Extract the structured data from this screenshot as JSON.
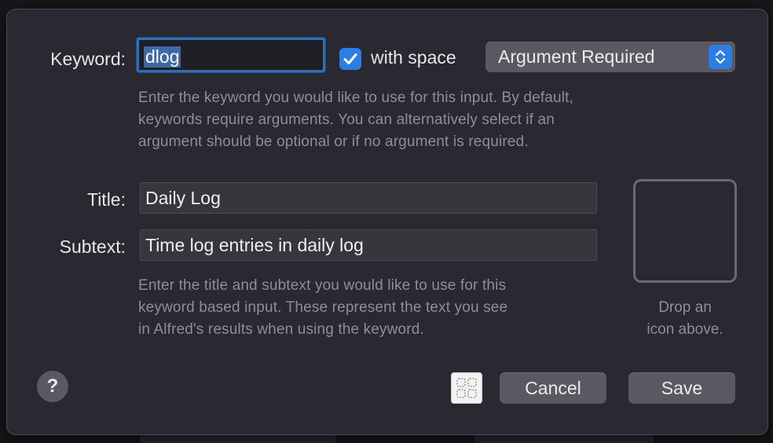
{
  "keyword": {
    "label": "Keyword:",
    "value": "dlog",
    "with_space_checked": true,
    "with_space_label": "with space",
    "argument_option": "Argument Required",
    "help": "Enter the keyword you would like to use for this input. By default, keywords require arguments. You can alternatively select if an argument should be optional or if no argument is required.",
    "help_lines": [
      "Enter the keyword you would like to use for this input. By default,",
      "keywords require arguments. You can alternatively select if an",
      "argument should be optional or if no argument is required."
    ]
  },
  "title": {
    "label": "Title:",
    "value": "Daily Log"
  },
  "subtext": {
    "label": "Subtext:",
    "value": "Time log entries in daily log"
  },
  "title_help_lines": [
    "Enter the title and subtext you would like to use for this",
    "keyword based input. These represent the text you see",
    "in Alfred's results when using the keyword."
  ],
  "icon_well": {
    "hint_lines": [
      "Drop an",
      "icon above."
    ]
  },
  "footer": {
    "help_label": "?",
    "cancel_label": "Cancel",
    "save_label": "Save"
  },
  "icons": {
    "checkbox": "checkmark-icon",
    "popup": "up-down-chevron-icon",
    "grid": "grid-icon"
  },
  "colors": {
    "accent": "#2e7de4",
    "sheet_bg": "#2a2830",
    "button_bg": "#5a5860"
  }
}
